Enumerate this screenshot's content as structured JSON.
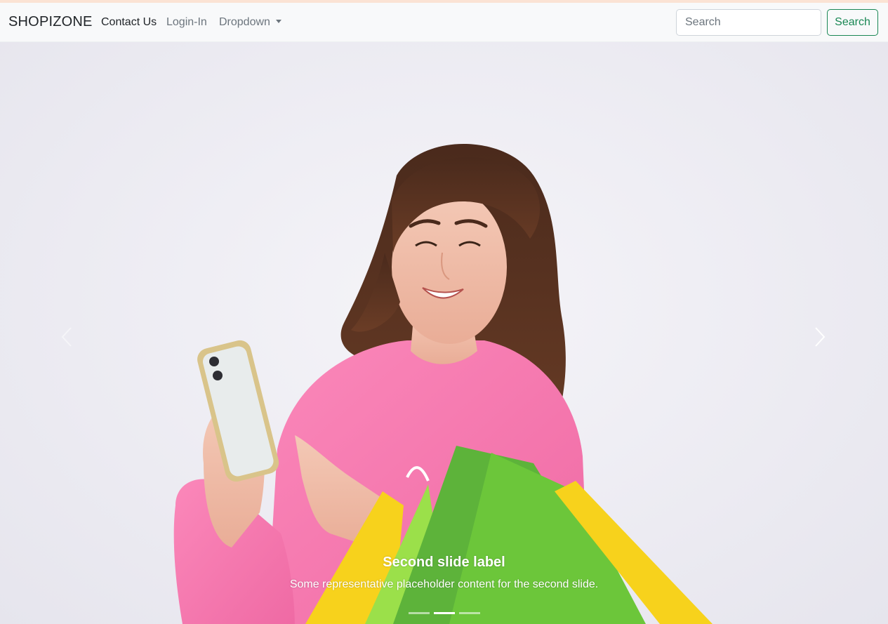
{
  "navbar": {
    "brand": "SHOPIZONE",
    "links": [
      {
        "label": "Contact Us",
        "active": true
      },
      {
        "label": "Login-In",
        "active": false
      },
      {
        "label": "Dropdown",
        "active": false
      }
    ],
    "search": {
      "placeholder": "Search",
      "value": "",
      "button_label": "Search"
    }
  },
  "carousel": {
    "active_slide": 2,
    "slide_count": 3,
    "caption_title": "Second slide label",
    "caption_text": "Some representative placeholder content for the second slide."
  },
  "colors": {
    "navbar_bg": "#f8f9fa",
    "search_button": "#198754",
    "sweater": "#f67bb0",
    "bag_green": "#6cc63a",
    "bag_yellow": "#f7d21c"
  },
  "icons": {
    "prev": "chevron-left-icon",
    "next": "chevron-right-icon",
    "dropdown": "caret-down-icon"
  }
}
